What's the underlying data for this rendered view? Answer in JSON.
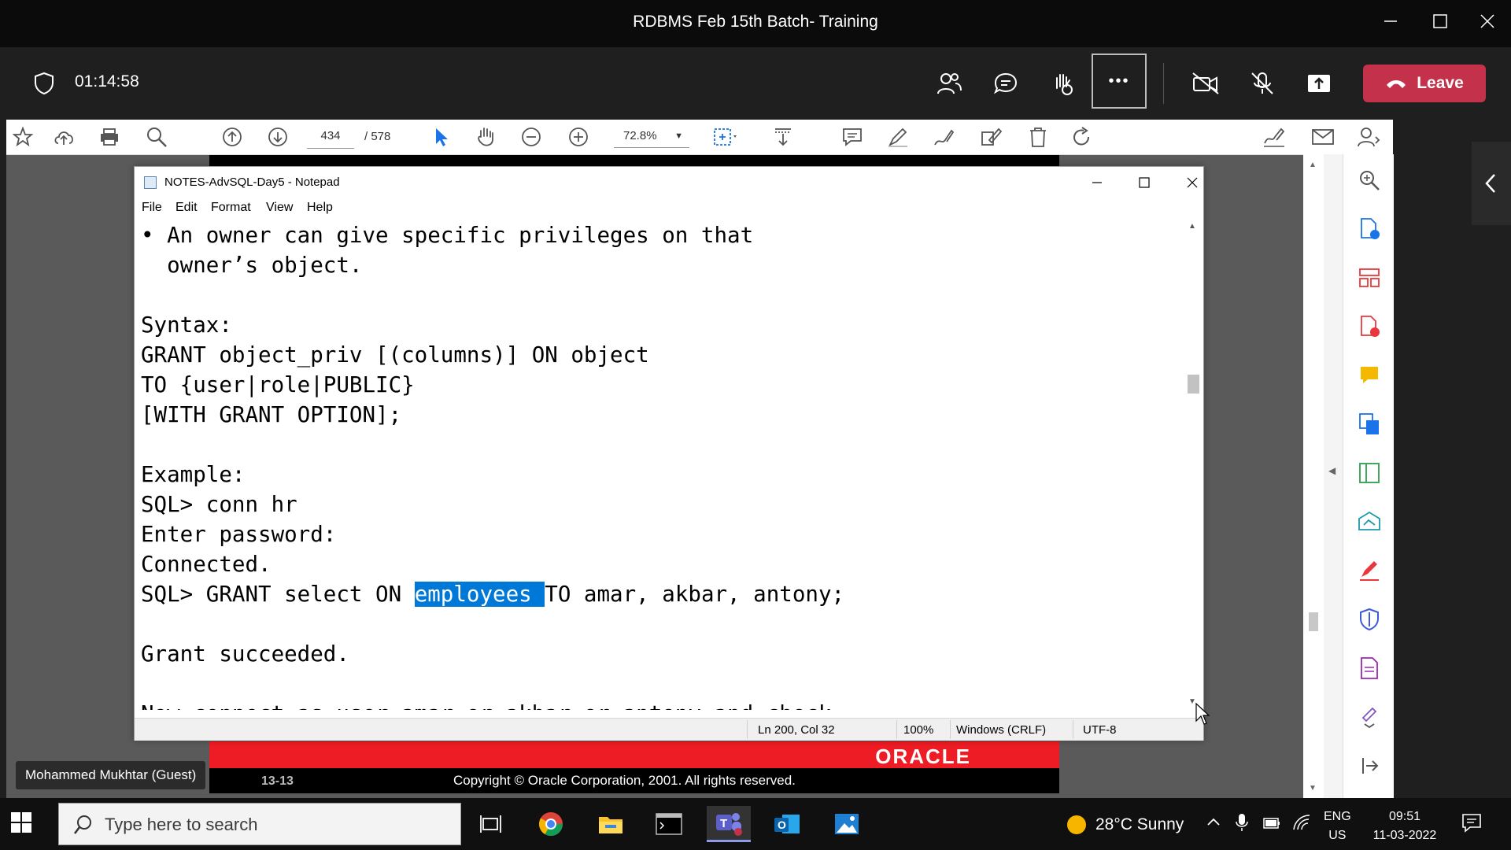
{
  "teams": {
    "window_title": "RDBMS Feb 15th Batch- Training",
    "timer": "01:14:58",
    "leave_label": "Leave",
    "more_label": "•••",
    "leave_color": "#c4314b"
  },
  "pdf_toolbar": {
    "page_current": "434",
    "page_total": "/ 578",
    "zoom": "72.8%"
  },
  "slide_footer": {
    "logo_text": "ORACLE",
    "slide_number": "13-13",
    "copyright": "Copyright © Oracle Corporation, 2001. All rights reserved.",
    "brand_color": "#ee1c25"
  },
  "participant": {
    "name": "Mohammed Mukhtar (Guest)"
  },
  "notepad": {
    "title": "NOTES-AdvSQL-Day5 - Notepad",
    "menu": [
      "File",
      "Edit",
      "Format",
      "View",
      "Help"
    ],
    "lines": [
      "• An owner can give specific privileges on that",
      "  owner’s object.",
      "",
      "Syntax:",
      "GRANT object_priv [(columns)] ON object",
      "TO {user|role|PUBLIC}",
      "[WITH GRANT OPTION];",
      "",
      "Example:",
      "SQL> conn hr",
      "Enter password:",
      "Connected."
    ],
    "grant_line": {
      "before": "SQL> GRANT select ON ",
      "selected": "employees ",
      "after": "TO amar, akbar, antony;"
    },
    "after_lines": [
      "",
      "Grant succeeded.",
      "",
      "Now connect as user amar or akbar or antony and check"
    ],
    "status": {
      "position": "Ln 200, Col 32",
      "zoom": "100%",
      "line_ending": "Windows (CRLF)",
      "encoding": "UTF-8"
    },
    "selection_color": "#0078d7"
  },
  "taskbar": {
    "search_placeholder": "Type here to search",
    "weather": "28°C  Sunny",
    "lang_top": "ENG",
    "lang_bottom": "US",
    "time": "09:51",
    "date": "11-03-2022"
  }
}
